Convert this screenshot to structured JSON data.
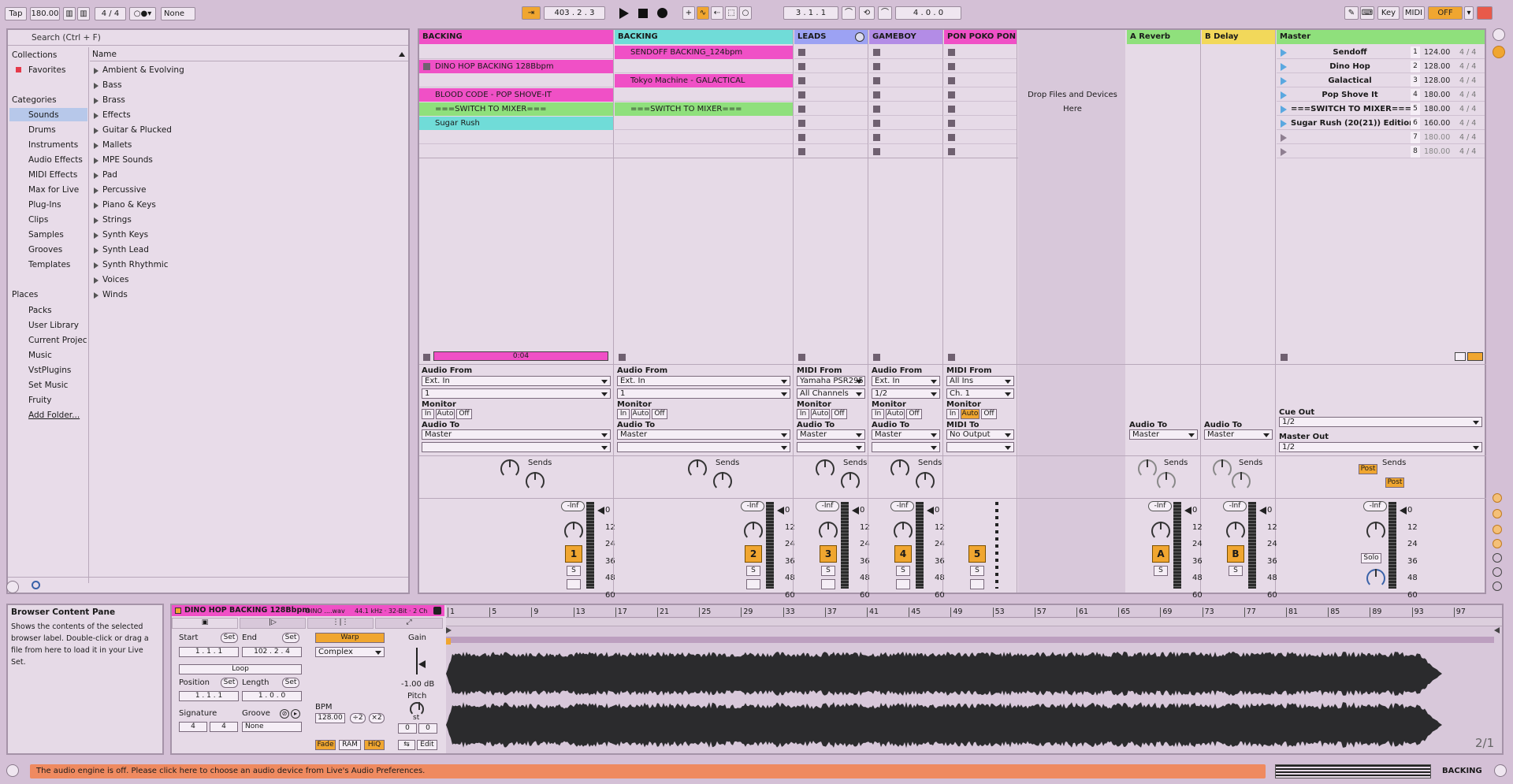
{
  "toolbar": {
    "tap": "Tap",
    "bpm": "180.00",
    "sig": "4 / 4",
    "quantize": "None",
    "position": "403 .   2 .   3",
    "loop_start": "3 .   1 .   1",
    "loop_len": "4 .   0 .   0",
    "key": "Key",
    "midi": "MIDI",
    "cpu": "OFF"
  },
  "browser": {
    "search_placeholder": "Search (Ctrl + F)",
    "collections_title": "Collections",
    "favorites": "Favorites",
    "categories_title": "Categories",
    "categories": [
      "Sounds",
      "Drums",
      "Instruments",
      "Audio Effects",
      "MIDI Effects",
      "Max for Live",
      "Plug-Ins",
      "Clips",
      "Samples",
      "Grooves",
      "Templates"
    ],
    "places_title": "Places",
    "places": [
      "Packs",
      "User Library",
      "Current Projec",
      "Music",
      "VstPlugins",
      "Set Music",
      "Fruity",
      "Add Folder..."
    ],
    "name_header": "Name",
    "items": [
      "Ambient & Evolving",
      "Bass",
      "Brass",
      "Effects",
      "Guitar & Plucked",
      "Mallets",
      "MPE Sounds",
      "Pad",
      "Percussive",
      "Piano & Keys",
      "Strings",
      "Synth Keys",
      "Synth Lead",
      "Synth Rhythmic",
      "Voices",
      "Winds"
    ]
  },
  "tracks": [
    {
      "name": "BACKING",
      "color": "#f050c6",
      "in_label": "Audio From",
      "in": "Ext. In",
      "ch": "1",
      "out_label": "Audio To",
      "out": "Master",
      "num": "1",
      "vol": "-Inf",
      "clips": [
        {
          "row": 1,
          "name": "DINO HOP BACKING 128Bbpm",
          "color": "#f050c6"
        },
        {
          "row": 3,
          "name": "BLOOD CODE - POP SHOVE-IT",
          "color": "#f050c6"
        },
        {
          "row": 4,
          "name": "===SWITCH TO MIXER===",
          "color": "#8fe07c"
        },
        {
          "row": 5,
          "name": "Sugar Rush",
          "color": "#70dcd8"
        }
      ],
      "time": "0:04"
    },
    {
      "name": "BACKING",
      "color": "#70dcd8",
      "in_label": "Audio From",
      "in": "Ext. In",
      "ch": "1",
      "out_label": "Audio To",
      "out": "Master",
      "num": "2",
      "vol": "-Inf",
      "clips": [
        {
          "row": 0,
          "name": "SENDOFF BACKING_124bpm",
          "color": "#f050c6"
        },
        {
          "row": 2,
          "name": "Tokyo Machine - GALACTICAL",
          "color": "#f050c6"
        },
        {
          "row": 4,
          "name": "===SWITCH TO MIXER===",
          "color": "#8fe07c"
        }
      ]
    },
    {
      "name": "LEADS",
      "color": "#9ca2f3",
      "in_label": "MIDI From",
      "in": "Yamaha PSR295",
      "ch": "All Channels",
      "out_label": "Audio To",
      "out": "Master",
      "num": "3",
      "vol": "-Inf",
      "clips": []
    },
    {
      "name": "GAMEBOY",
      "color": "#b38ce6",
      "in_label": "Audio From",
      "in": "Ext. In",
      "ch": "1/2",
      "out_label": "Audio To",
      "out": "Master",
      "num": "4",
      "vol": "-Inf",
      "clips": []
    },
    {
      "name": "PON POKO PON LI",
      "color": "#f050c6",
      "in_label": "MIDI From",
      "in": "All Ins",
      "ch": "Ch. 1",
      "out_label": "MIDI To",
      "out": "No Output",
      "num": "5",
      "vol": "",
      "clips": []
    }
  ],
  "monitor": {
    "label": "Monitor",
    "in": "In",
    "auto": "Auto",
    "off": "Off"
  },
  "sends_label": "Sends",
  "solo": "S",
  "scale": [
    "0",
    "12",
    "24",
    "36",
    "48",
    "60"
  ],
  "drop_text": "Drop Files and Devices Here",
  "returns": [
    {
      "name": "A Reverb",
      "color": "#8fe07c",
      "letter": "A",
      "out": "Master"
    },
    {
      "name": "B Delay",
      "color": "#f2d85a",
      "letter": "B",
      "out": "Master"
    }
  ],
  "master": {
    "name": "Master",
    "color": "#8fe07c",
    "cue_label": "Cue Out",
    "cue": "1/2",
    "out_label": "Master Out",
    "out": "1/2",
    "post": "Post",
    "solo": "Solo",
    "scenes": [
      {
        "n": "1",
        "name": "Sendoff",
        "bpm": "124.00",
        "sig": "4 / 4"
      },
      {
        "n": "2",
        "name": "Dino Hop",
        "bpm": "128.00",
        "sig": "4 / 4"
      },
      {
        "n": "3",
        "name": "Galactical",
        "bpm": "128.00",
        "sig": "4 / 4"
      },
      {
        "n": "4",
        "name": "Pop Shove It",
        "bpm": "180.00",
        "sig": "4 / 4"
      },
      {
        "n": "5",
        "name": "===SWITCH TO MIXER===",
        "bpm": "180.00",
        "sig": "4 / 4"
      },
      {
        "n": "6",
        "name": "Sugar Rush (20(21)) Edition",
        "bpm": "160.00",
        "sig": "4 / 4"
      },
      {
        "n": "7",
        "name": "",
        "bpm": "180.00",
        "sig": "4 / 4"
      },
      {
        "n": "8",
        "name": "",
        "bpm": "180.00",
        "sig": "4 / 4"
      }
    ]
  },
  "info": {
    "title": "Browser Content Pane",
    "text": "Shows the contents of the selected browser label. Double-click or drag a file from here to load it in your Live Set."
  },
  "clip": {
    "name": "DINO HOP BACKING 128Bbpm",
    "file": "DINO ....wav",
    "meta": "44.1 kHz · 32-Bit · 2 Ch",
    "start_label": "Start",
    "end_label": "End",
    "set": "Set",
    "start": "1 .   1 .   1",
    "end": "102 .   2 .   4",
    "loop": "Loop",
    "position_label": "Position",
    "length_label": "Length",
    "position": "1 .   1 .   1",
    "length": "1 .   0 .   0",
    "sig_label": "Signature",
    "groove_label": "Groove",
    "sig_num": "4",
    "sig_den": "4",
    "groove": "None",
    "warp": "Warp",
    "mode": "Complex",
    "bpm_label": "BPM",
    "bpm": "128.00",
    "half": "÷2",
    "double": "×2",
    "fade": "Fade",
    "ram": "RAM",
    "hiq": "HiQ",
    "gain_label": "Gain",
    "gain": "-1.00 dB",
    "pitch_label": "Pitch",
    "pitch_unit": "st",
    "pitch": "0",
    "cents": "0",
    "edit": "Edit"
  },
  "ruler": [
    "1",
    "5",
    "9",
    "13",
    "17",
    "21",
    "25",
    "29",
    "33",
    "37",
    "41",
    "45",
    "49",
    "53",
    "57",
    "61",
    "65",
    "69",
    "73",
    "77",
    "81",
    "85",
    "89",
    "93",
    "97"
  ],
  "zoom": "2/1",
  "status": {
    "message": "The audio engine is off. Please click here to choose an audio device from Live's Audio Preferences.",
    "track": "BACKING"
  }
}
